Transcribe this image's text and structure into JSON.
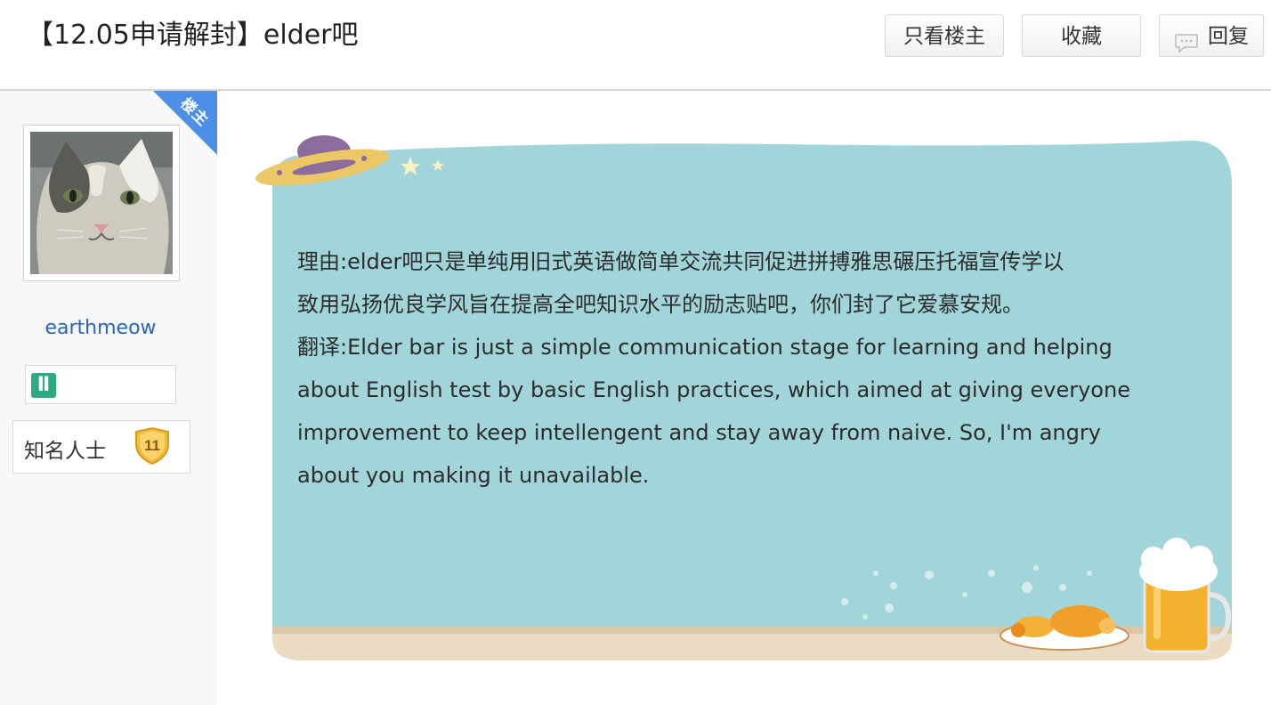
{
  "header": {
    "title": "【12.05申请解封】elder吧",
    "btn_only_op": "只看楼主",
    "btn_favorite": "收藏",
    "btn_reply": "回复"
  },
  "sidebar": {
    "corner_badge": "楼主",
    "username": "earthmeow",
    "zodiac_icon": "gemini-icon",
    "rank_title": "知名人士",
    "rank_level": "11"
  },
  "post": {
    "lines": [
      "理由:elder吧只是单纯用旧式英语做简单交流共同促进拼搏雅思碾压托福宣传学以",
      "致用弘扬优良学风旨在提高全吧知识水平的励志贴吧，你们封了它爱慕安规。",
      "翻译:Elder bar is just a simple communication stage for learning and helping",
      "about English test by basic English practices, which aimed at giving everyone",
      "improvement to keep intellengent and stay away from naive. So, I'm angry",
      "about you making it unavailable."
    ]
  },
  "colors": {
    "accent_blue": "#2d64b3",
    "post_background": "#a2d5da",
    "corner_badge": "#4d8fe6",
    "zodiac_green": "#2eaa7f",
    "rank_gold": "#f2bd39"
  }
}
